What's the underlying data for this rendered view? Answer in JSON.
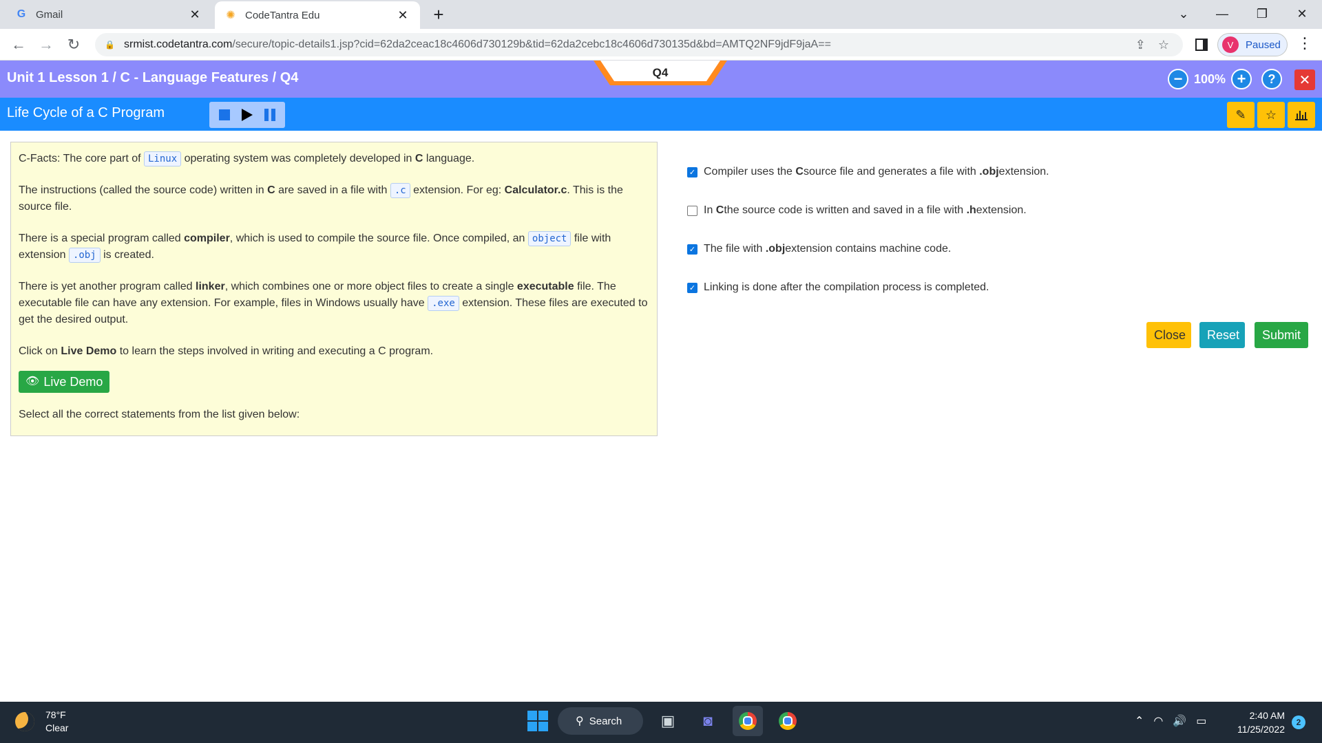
{
  "browser": {
    "tabs": [
      {
        "title": "Gmail",
        "icon": "gmail-icon"
      },
      {
        "title": "CodeTantra Edu",
        "icon": "codetantra-icon"
      }
    ],
    "url_domain": "srmist.codetantra.com",
    "url_path": "/secure/topic-details1.jsp?cid=62da2ceac18c4606d730129b&tid=62da2cebc18c4606d730135d&bd=AMTQ2NF9jdF9jaA==",
    "profile_initial": "V",
    "profile_status": "Paused"
  },
  "header": {
    "breadcrumb": "Unit 1 Lesson 1 / C - Language Features / Q4",
    "question_tab": "Q4",
    "zoom": "100%"
  },
  "subheader": {
    "title": "Life Cycle of a C Program"
  },
  "content": {
    "p1_pre": "C-Facts: The core part of ",
    "p1_code": "Linux",
    "p1_mid": " operating system was completely developed in ",
    "p1_bold": "C",
    "p1_post": " language.",
    "p2_pre": "The instructions (called the source code) written in ",
    "p2_bold1": "C",
    "p2_mid1": " are saved in a file with ",
    "p2_code": ".c",
    "p2_mid2": " extension. For eg: ",
    "p2_bold2": "Calculator.c",
    "p2_post": ". This is the source file.",
    "p3_pre": "There is a special program called ",
    "p3_bold": "compiler",
    "p3_mid1": ", which is used to compile the source file. Once compiled, an ",
    "p3_code1": "object",
    "p3_mid2": " file with extension ",
    "p3_code2": ".obj",
    "p3_post": " is created.",
    "p4_pre": "There is yet another program called ",
    "p4_bold1": "linker",
    "p4_mid1": ", which combines one or more object files to create a single ",
    "p4_bold2": "executable",
    "p4_mid2": " file. The executable file can have any extension. For example, files in Windows usually have ",
    "p4_code": ".exe",
    "p4_post": " extension. These files are executed to get the desired output.",
    "p5_pre": "Click on ",
    "p5_bold": "Live Demo",
    "p5_post": " to learn the steps involved in writing and executing a C program.",
    "live_demo_label": "Live Demo",
    "instruction": "Select all the correct statements from the list given below:"
  },
  "options": [
    {
      "checked": true,
      "t1": "Compiler uses the ",
      "b1": "C",
      "t2": " source file and generates a file with ",
      "b2": ".obj",
      "t3": " extension."
    },
    {
      "checked": false,
      "t1": "In ",
      "b1": "C",
      "t2": " the source code is written and saved in a file with ",
      "b2": ".h",
      "t3": " extension."
    },
    {
      "checked": true,
      "t1": "The file with ",
      "b1": ".obj",
      "t2": " extension contains machine code.",
      "b2": "",
      "t3": ""
    },
    {
      "checked": true,
      "t1": "Linking is done after the compilation process is completed.",
      "b1": "",
      "t2": "",
      "b2": "",
      "t3": ""
    }
  ],
  "buttons": {
    "close": "Close",
    "reset": "Reset",
    "submit": "Submit"
  },
  "taskbar": {
    "temperature": "78°F",
    "weather": "Clear",
    "search": "Search",
    "time": "2:40 AM",
    "date": "11/25/2022",
    "notifications": "2"
  },
  "colors": {
    "header_purple": "#8b8afb",
    "subheader_blue": "#1a8cff",
    "panel_yellow": "#fdfdd8",
    "close_btn": "#ffc107",
    "reset_btn": "#17a2b8",
    "submit_btn": "#28a745"
  }
}
